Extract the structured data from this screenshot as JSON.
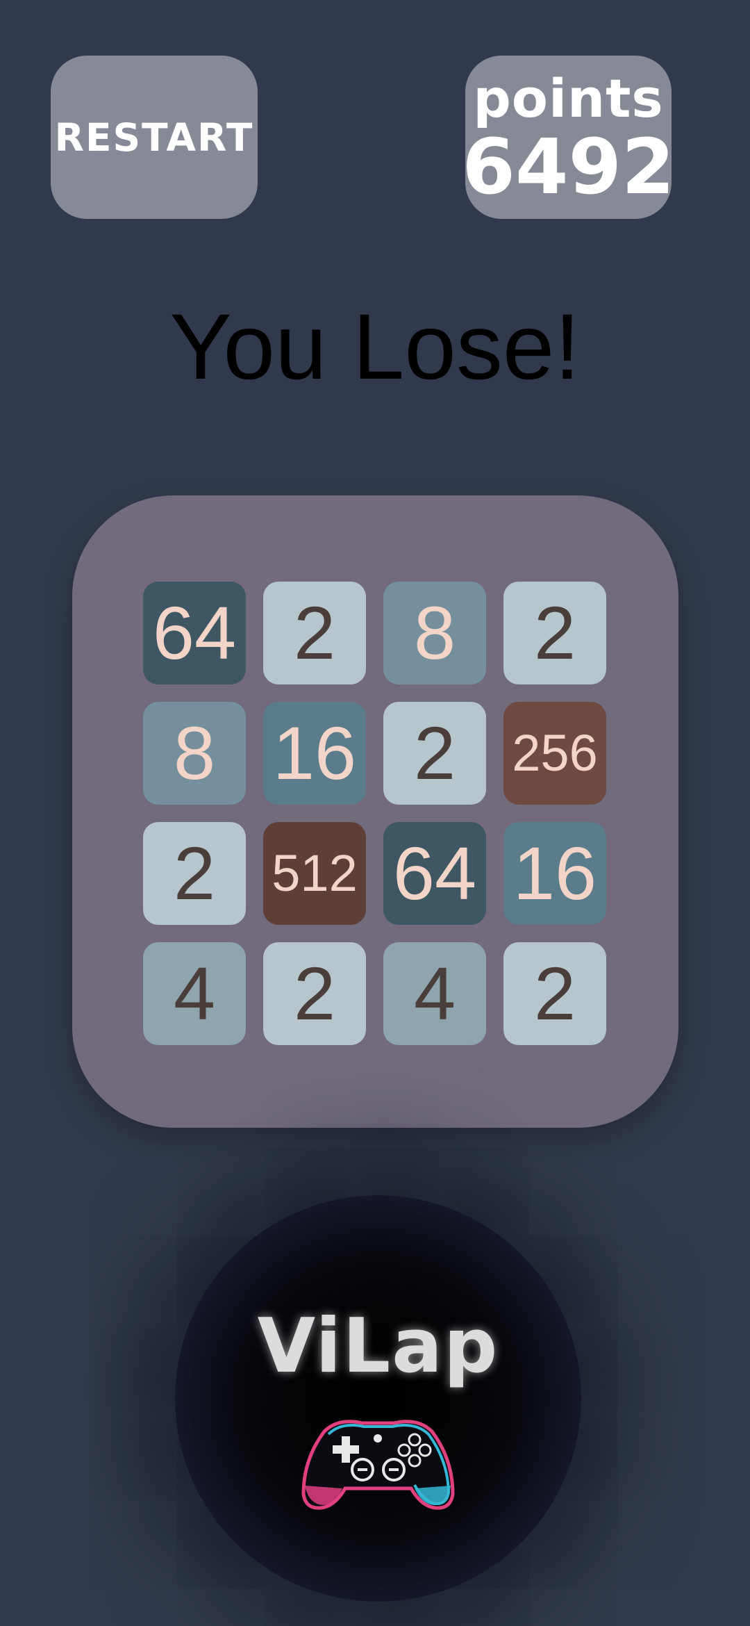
{
  "header": {
    "restart_label": "RESTART",
    "score_label": "points",
    "score_value": "6492"
  },
  "status": "You Lose!",
  "board": {
    "rows": [
      [
        "64",
        "2",
        "8",
        "2"
      ],
      [
        "8",
        "16",
        "2",
        "256"
      ],
      [
        "2",
        "512",
        "64",
        "16"
      ],
      [
        "4",
        "2",
        "4",
        "2"
      ]
    ]
  },
  "logo": {
    "text": "ViLap",
    "icon": "gamepad-icon"
  },
  "colors": {
    "background": "#313a4c",
    "button": "#858a96",
    "board": "#716b7c",
    "tile_2": "#b7c6cc",
    "tile_4": "#8fa4ad",
    "tile_8": "#75909c",
    "tile_16": "#5b7c8b",
    "tile_64": "#3f5663",
    "tile_256": "#6e4a43",
    "tile_512": "#5e3f38"
  }
}
